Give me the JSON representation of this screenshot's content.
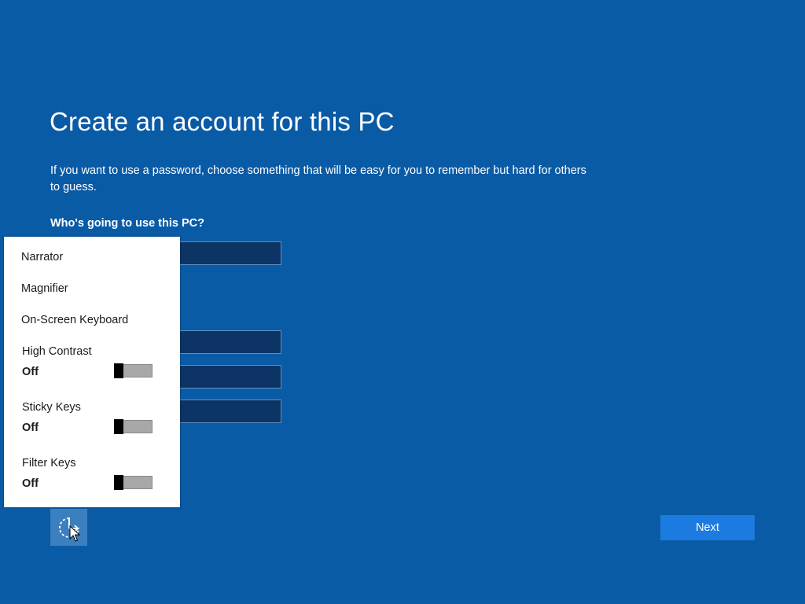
{
  "header": {
    "title": "Create an account for this PC",
    "description": "If you want to use a password, choose something that will be easy for you to remember but hard for others to guess."
  },
  "form": {
    "who_label": "Who's going to use this PC?",
    "username_value": "",
    "password_value": "",
    "reenter_value": "",
    "hint_value": ""
  },
  "ease_of_access_menu": {
    "items": [
      {
        "label": "Narrator"
      },
      {
        "label": "Magnifier"
      },
      {
        "label": "On-Screen Keyboard"
      }
    ],
    "toggles": [
      {
        "label": "High Contrast",
        "state": "Off"
      },
      {
        "label": "Sticky Keys",
        "state": "Off"
      },
      {
        "label": "Filter Keys",
        "state": "Off"
      }
    ]
  },
  "footer": {
    "ease_icon": "ease-of-access-icon",
    "next_label": "Next"
  },
  "colors": {
    "background": "#0a5ba6",
    "field": "#0c3566",
    "next_button": "#1c7be0",
    "ease_button": "#3c7fbf"
  }
}
